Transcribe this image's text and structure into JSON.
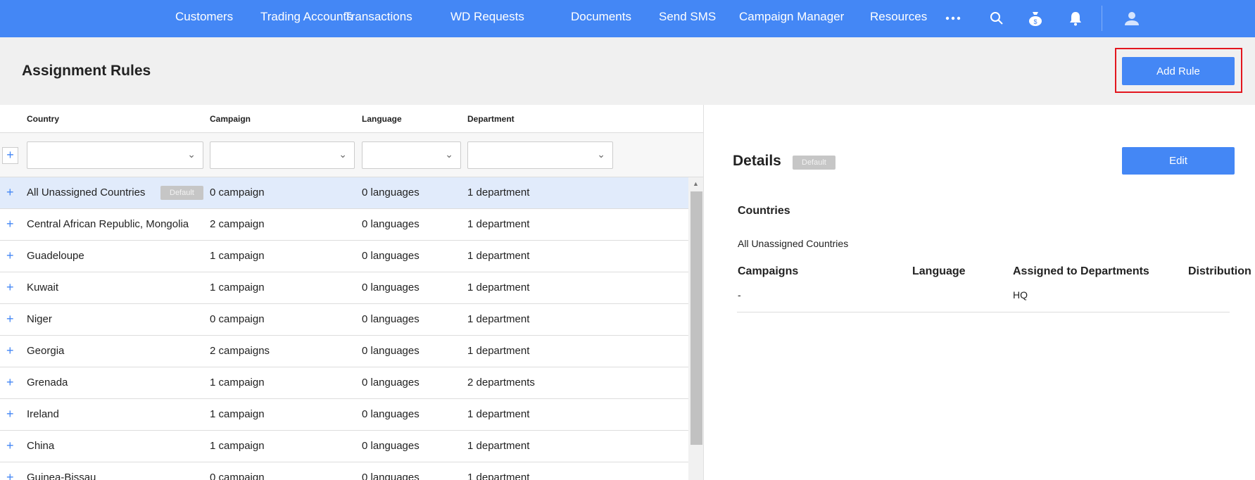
{
  "nav": {
    "items": [
      "Customers",
      "Trading Accounts",
      "Transactions",
      "WD Requests",
      "Documents",
      "Send SMS",
      "Campaign Manager",
      "Resources"
    ],
    "icons": [
      "more-icon",
      "search-icon",
      "money-bag-icon",
      "bell-icon",
      "user-icon"
    ]
  },
  "header": {
    "title": "Assignment Rules",
    "add_rule": "Add Rule"
  },
  "table": {
    "columns": [
      "Country",
      "Campaign",
      "Language",
      "Department"
    ],
    "rows": [
      {
        "country": "All Unassigned Countries",
        "badge": "Default",
        "campaign": "0 campaign",
        "language": "0 languages",
        "department": "1 department"
      },
      {
        "country": "Central African Republic, Mongolia",
        "campaign": "2 campaign",
        "language": "0 languages",
        "department": "1 department"
      },
      {
        "country": "Guadeloupe",
        "campaign": "1 campaign",
        "language": "0 languages",
        "department": "1 department"
      },
      {
        "country": "Kuwait",
        "campaign": "1 campaign",
        "language": "0 languages",
        "department": "1 department"
      },
      {
        "country": "Niger",
        "campaign": "0 campaign",
        "language": "0 languages",
        "department": "1 department"
      },
      {
        "country": "Georgia",
        "campaign": "2 campaigns",
        "language": "0 languages",
        "department": "1 department"
      },
      {
        "country": "Grenada",
        "campaign": "1 campaign",
        "language": "0 languages",
        "department": "2 departments"
      },
      {
        "country": "Ireland",
        "campaign": "1 campaign",
        "language": "0 languages",
        "department": "1 department"
      },
      {
        "country": "China",
        "campaign": "1 campaign",
        "language": "0 languages",
        "department": "1 department"
      },
      {
        "country": "Guinea-Bissau",
        "campaign": "0 campaign",
        "language": "0 languages",
        "department": "1 department"
      }
    ]
  },
  "details": {
    "title": "Details",
    "badge": "Default",
    "edit": "Edit",
    "countries_label": "Countries",
    "countries_value": "All Unassigned Countries",
    "headers": [
      "Campaigns",
      "Language",
      "Assigned to Departments",
      "Distribution"
    ],
    "values": {
      "campaigns": "-",
      "language": "",
      "departments": "HQ",
      "distribution": ""
    }
  }
}
